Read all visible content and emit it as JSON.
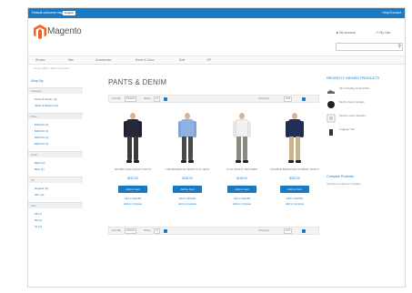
{
  "topbar": {
    "label": "Default welcome msg!",
    "lang": "English",
    "right_link": "Help/Contact"
  },
  "header": {
    "logo_text": "Magento",
    "account_link": "My Account",
    "cart_link": "My Cart",
    "search_placeholder": ""
  },
  "nav": {
    "items": [
      "Women",
      "Men",
      "Accessories",
      "Home & Decor",
      "Sale",
      "VIP"
    ]
  },
  "breadcrumb": "Home / Men / Pants & Denim",
  "sidebar": {
    "heading": "Shop By",
    "sections": [
      {
        "title": "Category",
        "links": [
          "Pants & Denim (4)",
          "Shirts & Blazers (4)"
        ]
      },
      {
        "title": "Price",
        "links": [
          "$100.00 (2)",
          "$200.00 (1)",
          "$300.00 (1)",
          "$400.00 (1)"
        ]
      },
      {
        "title": "Color",
        "links": [
          "Black (2)",
          "Blue (1)"
        ]
      },
      {
        "title": "Fit",
        "links": [
          "Regular (2)",
          "Slim (2)"
        ]
      },
      {
        "title": "Size",
        "links": [
          "28 (2)",
          "30 (4)",
          "32 (4)"
        ]
      }
    ]
  },
  "main": {
    "title": "PANTS & DENIM",
    "toolbar_top": {
      "sort_label": "Sort By",
      "sort_value": "Position",
      "show_label": "Show",
      "show_value": "12",
      "count": "4 Item(s)",
      "view": "Grid"
    },
    "toolbar_bottom": {
      "sort_label": "Sort By",
      "sort_value": "Position",
      "show_label": "Show",
      "show_value": "12",
      "count": "4 Item(s)",
      "view": "Grid"
    },
    "products": [
      {
        "name": "DUMBO HIGH WAIST PANTS",
        "price": "$210.00",
        "button": "Add to Cart",
        "wish": "Add to Wishlist",
        "compare": "Add to Compare"
      },
      {
        "name": "THE ESSENTIAL BOOT CUT JEAN",
        "price": "$140.00",
        "button": "Add to Cart",
        "wish": "Add to Wishlist",
        "compare": "Add to Compare"
      },
      {
        "name": "FLAT FRONT TROUSER",
        "price": "$145.00",
        "button": "Add to Cart",
        "wish": "Add to Wishlist",
        "compare": "Add to Compare"
      },
      {
        "name": "DOUBLE BREASTED FORMAL PANTS",
        "price": "$210.00",
        "button": "Add to Cart",
        "wish": "Add to Wishlist",
        "compare": "Add to Compare"
      }
    ]
  },
  "right": {
    "compare_heading": "RECENTLY VIEWED PRODUCTS",
    "recent": [
      {
        "name": "Slim-fit Dobby Oxford Shirt",
        "icon": "shoe-icon"
      },
      {
        "name": "Merino Wool Cardigan",
        "icon": "sweater-icon"
      },
      {
        "name": "Stretch Cotton Sweater",
        "icon": "shirt-icon"
      },
      {
        "name": "Luggage Tote",
        "icon": "bag-icon"
      }
    ],
    "wish_heading": "Compare Products",
    "wish_text": "You have no items to compare."
  },
  "colors": {
    "accent": "#1979c3"
  }
}
